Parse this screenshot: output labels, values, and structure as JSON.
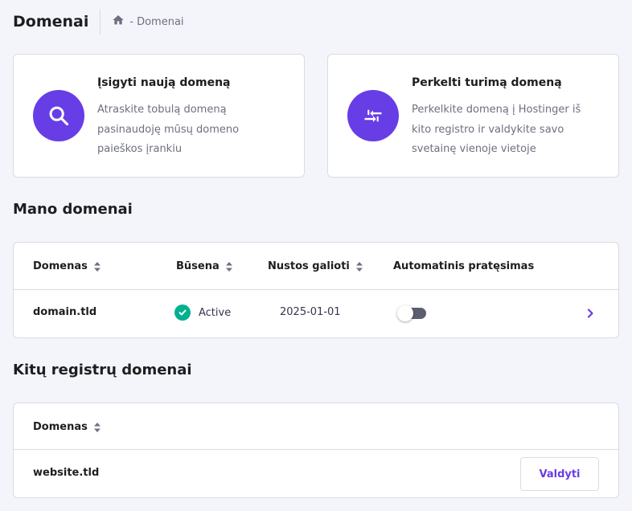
{
  "header": {
    "title": "Domenai",
    "breadcrumb_sep": "-",
    "breadcrumb_current": "Domenai"
  },
  "cards": [
    {
      "title": "Įsigyti naują domeną",
      "description": "Atraskite tobulą domeną pasinaudoję mūsų domeno paieškos įrankiu",
      "icon": "search-icon"
    },
    {
      "title": "Perkelti turimą domeną",
      "description": "Perkelkite domeną į Hostinger iš kito registro ir valdykite savo svetainę vienoje vietoje",
      "icon": "transfer-icon"
    }
  ],
  "my_domains": {
    "section_title": "Mano domenai",
    "columns": [
      "Domenas",
      "Būsena",
      "Nustos galioti",
      "Automatinis pratęsimas"
    ],
    "rows": [
      {
        "domain": "domain.tld",
        "status": "Active",
        "expires": "2025-01-01",
        "auto_renew": false
      }
    ]
  },
  "other_domains": {
    "section_title": "Kitų registrų domenai",
    "columns": [
      "Domenas"
    ],
    "rows": [
      {
        "domain": "website.tld",
        "action_label": "Valdyti"
      }
    ]
  },
  "colors": {
    "accent": "#673de6",
    "success": "#00b090",
    "background": "#f4f4fb"
  }
}
